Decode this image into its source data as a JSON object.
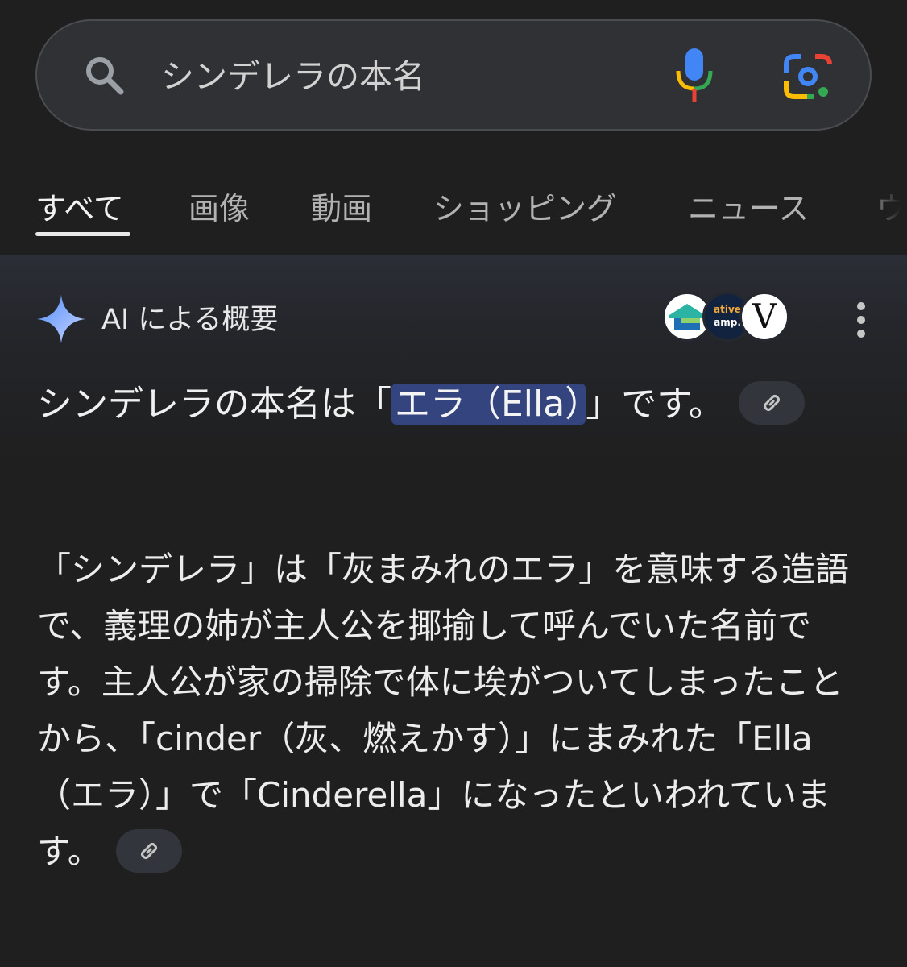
{
  "search": {
    "query": "シンデレラの本名"
  },
  "tabs": [
    {
      "label": "すべて",
      "active": true
    },
    {
      "label": "画像",
      "active": false
    },
    {
      "label": "動画",
      "active": false
    },
    {
      "label": "ショッピング",
      "active": false
    },
    {
      "label": "ニュース",
      "active": false
    },
    {
      "label": "ウ",
      "active": false
    }
  ],
  "ai_overview": {
    "title": "AI による概要",
    "sources": [
      {
        "name": "source-1",
        "badge": ""
      },
      {
        "name": "source-2",
        "badge_top": "ative",
        "badge_bottom": "amp."
      },
      {
        "name": "source-3",
        "badge": "V"
      }
    ],
    "answer_before": "シンデレラの本名は「",
    "answer_highlight": "エラ（Ella）",
    "answer_after": "」です。",
    "detail_text": "「シンデレラ」は「灰まみれのエラ」を意味する造語で、義理の姉が主人公を揶揄して呼んでいた名前です。主人公が家の掃除で体に埃がついてしまったことから、「cinder（灰、燃えかす）」にまみれた「Ella（エラ）」で「Cinderella」になったといわれています。"
  },
  "colors": {
    "background": "#1f1f1f",
    "search_bg": "#303134",
    "highlight_bg": "#34447e",
    "google_blue": "#4285f4",
    "google_red": "#ea4335",
    "google_yellow": "#fbbc04",
    "google_green": "#34a853"
  }
}
